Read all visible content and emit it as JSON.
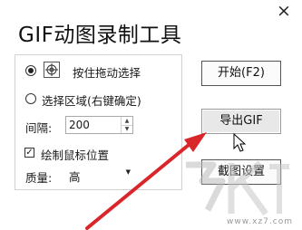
{
  "window": {
    "title": "GIF动图录制工具",
    "close_glyph": "×"
  },
  "options": {
    "hold_drag_label": "按住拖动选择",
    "select_region_label": "选择区域(右键确定)",
    "interval_label": "间隔:",
    "interval_value": "200",
    "draw_cursor_label": "绘制鼠标位置",
    "draw_cursor_checked": true,
    "quality_label": "质量:",
    "quality_value": "高"
  },
  "buttons": {
    "start": "开始(F2)",
    "export": "导出GIF",
    "screenshot_settings": "截图设置"
  },
  "watermark": {
    "text": "www.xz7.com"
  },
  "colors": {
    "arrow": "#d9262b"
  },
  "icons": {
    "crosshair": "crosshair-icon",
    "close": "close-icon",
    "cursor": "mouse-cursor-icon"
  }
}
